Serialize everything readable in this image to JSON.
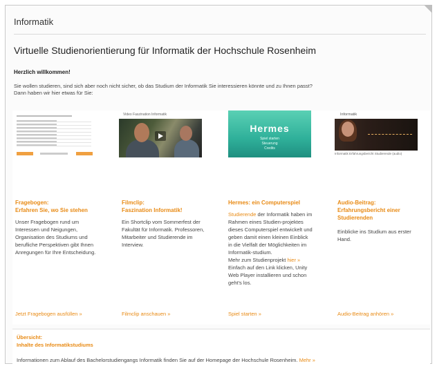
{
  "app_title": "Informatik",
  "page_title": "Virtuelle Studienorientierung für Informatik der Hochschule Rosenheim",
  "welcome": "Herzlich willkommen!",
  "intro_line1": "Sie wollen studieren, sind sich aber noch nicht sicher, ob das Studium der Informatik Sie interessieren könnte und zu Ihnen passt?",
  "intro_line2": "Dann haben wir hier etwas für Sie:",
  "columns": [
    {
      "title1": "Fragebogen:",
      "title2": "Erfahren Sie, wo Sie stehen",
      "text": "Unser Fragebogen rund um Interessen und Neigungen, Organisation des Studiums und berufliche Perspektiven gibt Ihnen Anregungen für Ihre Entscheidung.",
      "link": "Jetzt Fragebogen ausfüllen »"
    },
    {
      "title1": "Filmclip:",
      "title2": "Faszination Informatik!",
      "thumb_caption": "Video Faszination Informatik",
      "text": "Ein Shortclip vom Sommerfest der Fakultät für Informatik. Professoren, Mitarbeiter und Studierende im Interview.",
      "link": "Filmclip anschauen »"
    },
    {
      "title1": "Hermes: ein Computerspiel",
      "thumb_title": "Hermes",
      "thumb_menu1": "Spiel starten",
      "thumb_menu2": "Steuerung",
      "thumb_menu3": "Credits",
      "text_link": "Studierende",
      "text_rest": " der Informatik haben im Rahmen eines Studien-projektes dieses Computerspiel entwickelt und geben damit einen kleinen Einblick in die Vielfalt der Möglichkeiten im Informatik-studium.",
      "more_prefix": "Mehr zum Studienprojekt ",
      "more_link": "hier »",
      "more_suffix": "Einfach auf den Link klicken, Unity Web Player installieren und schon geht's los.",
      "link": "Spiel starten »"
    },
    {
      "title1": "Audio-Beitrag:",
      "title2": "Erfahrungsbericht einer",
      "title3": "Studierenden",
      "thumb_caption": "Informatik",
      "thumb_sub": "Informatik Erfahrungsbericht Studierende (audio)",
      "text": "Einblicke ins Studium aus erster Hand.",
      "link": "Audio-Beitrag anhören »"
    }
  ],
  "overview": {
    "title1": "Übersicht:",
    "title2": "Inhalte des Informatikstudiums",
    "text": "Informationen zum Ablauf des Bachelorstudiengangs Informatik finden Sie auf der Homepage der Hochschule Rosenheim.",
    "link": " Mehr »"
  }
}
